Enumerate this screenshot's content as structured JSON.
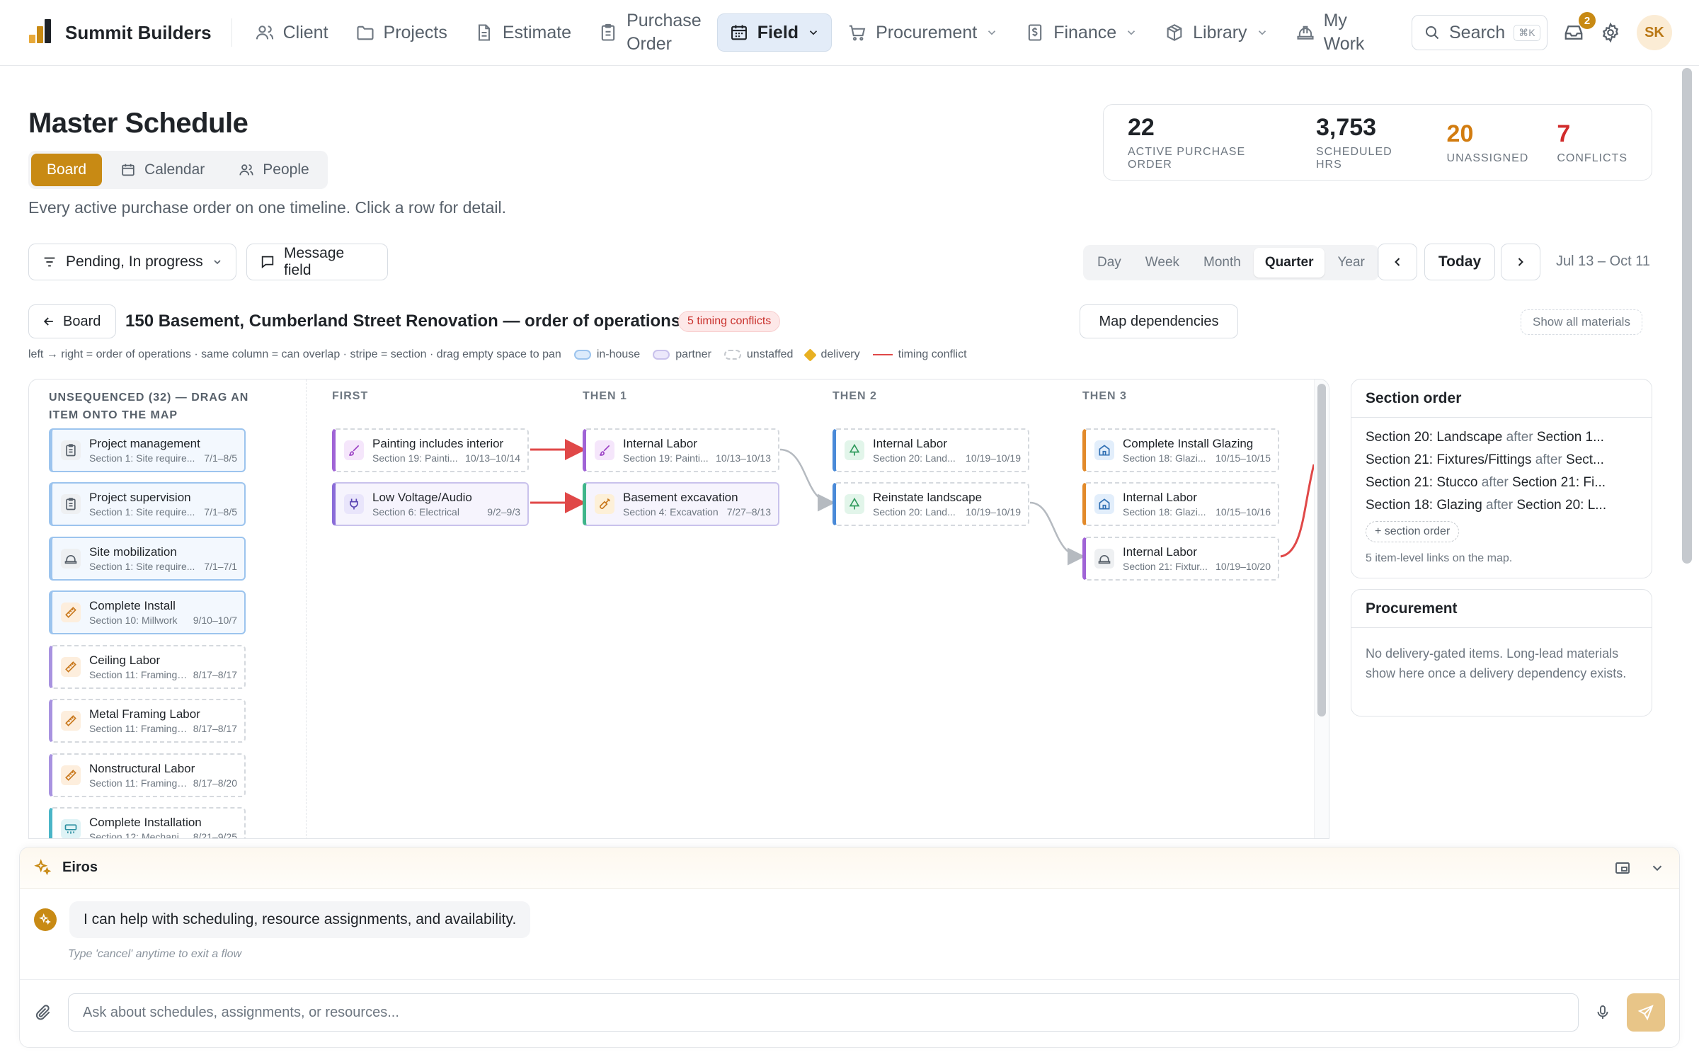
{
  "brand": {
    "name": "Summit Builders"
  },
  "nav": {
    "items": [
      {
        "label": "Client",
        "icon": "users-icon"
      },
      {
        "label": "Projects",
        "icon": "folder-icon"
      },
      {
        "label": "Estimate",
        "icon": "file-icon"
      },
      {
        "label_line1": "Purchase",
        "label_line2": "Order",
        "icon": "clipboard-icon"
      },
      {
        "label": "Field",
        "icon": "calendar-icon",
        "active": true
      },
      {
        "label": "Procurement",
        "icon": "cart-icon"
      },
      {
        "label": "Finance",
        "icon": "dollar-doc-icon"
      },
      {
        "label": "Library",
        "icon": "box-icon"
      },
      {
        "label_line1": "My",
        "label_line2": "Work",
        "icon": "hardhat-icon"
      }
    ],
    "search_label": "Search",
    "search_kbd": "⌘K",
    "inbox_count": "2",
    "avatar_initials": "SK"
  },
  "page": {
    "title": "Master Schedule",
    "subtitle": "Every active purchase order on one timeline. Click a row for detail.",
    "views": {
      "board": "Board",
      "calendar": "Calendar",
      "people": "People"
    }
  },
  "stats": [
    {
      "value": "22",
      "label": "ACTIVE PURCHASE ORDER",
      "color": "#1f2328"
    },
    {
      "value": "3,753",
      "label": "SCHEDULED HRS",
      "color": "#1f2328"
    },
    {
      "value": "20",
      "label": "UNASSIGNED",
      "color": "#d27c10"
    },
    {
      "value": "7",
      "label": "CONFLICTS",
      "color": "#d12b2b"
    }
  ],
  "filters": {
    "status": "Pending, In progress",
    "message": "Message field",
    "ranges": [
      "Day",
      "Week",
      "Month",
      "Quarter",
      "Year"
    ],
    "active_range": "Quarter",
    "today": "Today",
    "range_label": "Jul 13 – Oct 11"
  },
  "map": {
    "back": "Board",
    "title": "150 Basement, Cumberland Street Renovation — order of operations",
    "conflicts": "5 timing conflicts",
    "map_dependencies": "Map dependencies",
    "show_all_materials": "Show all materials",
    "hint": "left → right = order of operations · same column = can overlap · stripe = section · drag empty space to pan",
    "legend": {
      "inhouse": "in-house",
      "partner": "partner",
      "unstaffed": "unstaffed",
      "delivery": "delivery",
      "conflict": "timing conflict"
    },
    "unsequenced_title": "UNSEQUENCED (32) — DRAG AN ITEM ONTO THE MAP",
    "columns": [
      "FIRST",
      "THEN 1",
      "THEN 2",
      "THEN 3"
    ],
    "unsequenced": [
      {
        "title": "Project management",
        "section": "Section 1: Site require...",
        "dates": "7/1–8/5"
      },
      {
        "title": "Project supervision",
        "section": "Section 1: Site require...",
        "dates": "7/1–8/5"
      },
      {
        "title": "Site mobilization",
        "section": "Section 1: Site require...",
        "dates": "7/1–7/1"
      },
      {
        "title": "Complete Install",
        "section": "Section 10: Millwork",
        "dates": "9/10–10/7"
      },
      {
        "title": "Ceiling Labor",
        "section": "Section 11: Framing ...",
        "dates": "8/17–8/17"
      },
      {
        "title": "Metal Framing Labor",
        "section": "Section 11: Framing ...",
        "dates": "8/17–8/17"
      },
      {
        "title": "Nonstructural Labor",
        "section": "Section 11: Framing ...",
        "dates": "8/17–8/20"
      },
      {
        "title": "Complete Installation",
        "section": "Section 12: Mechani...",
        "dates": "8/21–9/25"
      }
    ],
    "sequenced": [
      {
        "title": "Painting includes interior",
        "section": "Section 19: Painti...",
        "dates": "10/13–10/14"
      },
      {
        "title": "Low Voltage/Audio",
        "section": "Section 6: Electrical",
        "dates": "9/2–9/3"
      },
      {
        "title": "Internal Labor",
        "section": "Section 19: Painti...",
        "dates": "10/13–10/13"
      },
      {
        "title": "Basement excavation",
        "section": "Section 4: Excavation",
        "dates": "7/27–8/13"
      },
      {
        "title": "Internal Labor",
        "section": "Section 20: Land...",
        "dates": "10/19–10/19"
      },
      {
        "title": "Reinstate landscape",
        "section": "Section 20: Land...",
        "dates": "10/19–10/19"
      },
      {
        "title": "Complete Install Glazing",
        "section": "Section 18: Glazi...",
        "dates": "10/15–10/15"
      },
      {
        "title": "Internal Labor",
        "section": "Section 18: Glazi...",
        "dates": "10/15–10/16"
      },
      {
        "title": "Internal Labor",
        "section": "Section 21: Fixtur...",
        "dates": "10/19–10/20"
      }
    ]
  },
  "section_order": {
    "title": "Section order",
    "rows": [
      {
        "a": "Section 20: Landscape",
        "b": "Section 1..."
      },
      {
        "a": "Section 21: Fixtures/Fittings",
        "b": "Sect..."
      },
      {
        "a": "Section 21: Stucco",
        "b": "Section 21: Fi..."
      },
      {
        "a": "Section 18: Glazing",
        "b": "Section 20: L..."
      }
    ],
    "after_word": "after",
    "add": "+ section order",
    "note": "5 item-level links on the map."
  },
  "procurement": {
    "title": "Procurement",
    "text": "No delivery-gated items. Long-lead materials show here once a delivery dependency exists."
  },
  "assistant": {
    "name": "Eiros",
    "message": "I can help with scheduling, resource assignments, and availability.",
    "hint": "Type 'cancel' anytime to exit a flow",
    "placeholder": "Ask about schedules, assignments, or resources..."
  },
  "colors": {
    "accent": "#c88a14",
    "conflict": "#e04848",
    "inhouse": "#9cc4ee",
    "partner": "#c9c2ec"
  }
}
